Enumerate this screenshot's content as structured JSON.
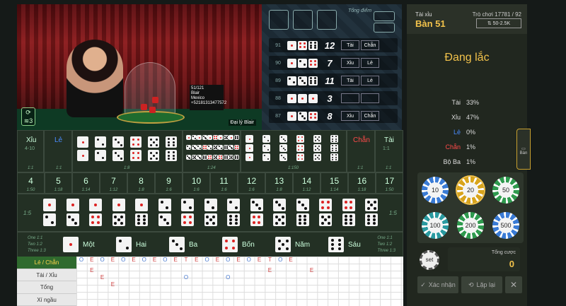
{
  "video": {
    "dealer_label": "Đại lý Blair",
    "wifi_count": "3",
    "info_card": [
      "51/121",
      "Blair",
      "Mexico",
      "+52181313477572"
    ]
  },
  "history": {
    "total_label": "Tổng điểm",
    "rows": [
      {
        "id": "91",
        "dice": [
          1,
          4,
          6
        ],
        "sum": "12",
        "badges": [
          "Tài",
          "Chẵn"
        ]
      },
      {
        "id": "90",
        "dice": [
          1,
          2,
          4
        ],
        "sum": "7",
        "badges": [
          "Xỉu",
          "Lẻ"
        ]
      },
      {
        "id": "89",
        "dice": [
          2,
          3,
          6
        ],
        "sum": "11",
        "badges": [
          "Tài",
          "Lẻ"
        ]
      },
      {
        "id": "88",
        "dice": [
          1,
          1,
          1
        ],
        "sum": "3",
        "badges": [
          "",
          ""
        ]
      },
      {
        "id": "87",
        "dice": [
          1,
          3,
          4
        ],
        "sum": "8",
        "badges": [
          "Xỉu",
          "Chẵn"
        ]
      }
    ]
  },
  "panel": {
    "game_type": "Tài xỉu",
    "table_name": "Bàn 51",
    "round_info": "Trò chơi 17781 / 92",
    "limit": "50-2.5K",
    "status": "Đang lắc",
    "stats": [
      {
        "label": "Tài",
        "value": "33%",
        "color": "#dddddd"
      },
      {
        "label": "Xỉu",
        "value": "47%",
        "color": "#dddddd"
      },
      {
        "label": "Lẻ",
        "value": "0%",
        "color": "#4a8cff"
      },
      {
        "label": "Chẵn",
        "value": "1%",
        "color": "#ff4a4a"
      },
      {
        "label": "Bộ Ba",
        "value": "1%",
        "color": "#dddddd"
      }
    ],
    "chips": [
      "10",
      "20",
      "50",
      "100",
      "200",
      "500"
    ],
    "set_label": "set",
    "total_bet_label": "Tổng cược",
    "total_bet_value": "0",
    "confirm_label": "Xác nhận",
    "repeat_label": "Lặp lại",
    "side_tab_label": "Bàn"
  },
  "board": {
    "xiu": {
      "label": "Xỉu",
      "range": "4-10",
      "odds": "1:1"
    },
    "le": {
      "label": "Lẻ",
      "odds": "1:1"
    },
    "chan": {
      "label": "Chẵn",
      "odds": "1:1"
    },
    "tai": {
      "label": "Tài",
      "range": "11-17",
      "odds": "1:1"
    },
    "pair_odds": "1:8",
    "combo_odds": "1:24",
    "triple_odds": "1:150",
    "totals": [
      {
        "n": "4",
        "o": "1:50"
      },
      {
        "n": "5",
        "o": "1:18"
      },
      {
        "n": "6",
        "o": "1:14"
      },
      {
        "n": "7",
        "o": "1:12"
      },
      {
        "n": "8",
        "o": "1:8"
      },
      {
        "n": "9",
        "o": "1:6"
      },
      {
        "n": "10",
        "o": "1:6"
      },
      {
        "n": "11",
        "o": "1:6"
      },
      {
        "n": "12",
        "o": "1:6"
      },
      {
        "n": "13",
        "o": "1:8"
      },
      {
        "n": "14",
        "o": "1:12"
      },
      {
        "n": "15",
        "o": "1:14"
      },
      {
        "n": "16",
        "o": "1:18"
      },
      {
        "n": "17",
        "o": "1:50"
      }
    ],
    "two_dice_odds": "1:5",
    "single_odds": [
      "One 1:1",
      "Two 1:2",
      "Three 1:3"
    ],
    "singles": [
      "Một",
      "Hai",
      "Ba",
      "Bốn",
      "Năm",
      "Sáu"
    ]
  },
  "roadmap": {
    "tabs": [
      "Lẻ / Chẵn",
      "Tài / Xỉu",
      "Tổng",
      "Xí ngầu"
    ],
    "row1": [
      "O",
      "E",
      "O",
      "E",
      "O",
      "E",
      "O",
      "E",
      "O",
      "E",
      "T",
      "E",
      "O",
      "E",
      "O",
      "E",
      "O",
      "E",
      "T",
      "O",
      "E"
    ],
    "row2": [
      {
        "c": 1,
        "t": "E"
      },
      {
        "c": 18,
        "t": "E"
      },
      {
        "c": 22,
        "t": "E"
      }
    ],
    "row3": [
      {
        "c": 2,
        "t": "E"
      },
      {
        "c": 10,
        "t": "O"
      },
      {
        "c": 14,
        "t": "O"
      }
    ],
    "row4": [
      {
        "c": 3,
        "t": "E"
      }
    ]
  }
}
